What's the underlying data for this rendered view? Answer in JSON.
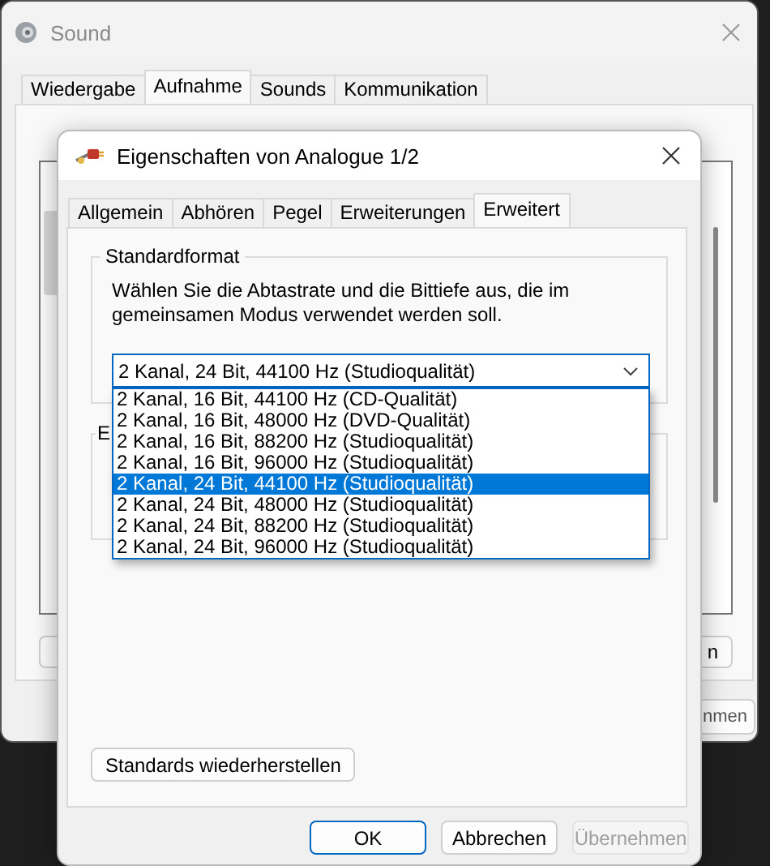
{
  "back_window": {
    "title": "Sound",
    "tabs": [
      {
        "label": "Wiedergabe",
        "selected": false
      },
      {
        "label": "Aufnahme",
        "selected": true
      },
      {
        "label": "Sounds",
        "selected": false
      },
      {
        "label": "Kommunikation",
        "selected": false
      }
    ],
    "buttons": [
      "n"
    ],
    "footer_buttons": [
      "nmen"
    ]
  },
  "dialog": {
    "title": "Eigenschaften von Analogue 1/2",
    "tabs": [
      {
        "label": "Allgemein",
        "selected": false
      },
      {
        "label": "Abhören",
        "selected": false
      },
      {
        "label": "Pegel",
        "selected": false
      },
      {
        "label": "Erweiterungen",
        "selected": false
      },
      {
        "label": "Erweitert",
        "selected": true
      }
    ],
    "format_group": {
      "title": "Standardformat",
      "description": "Wählen Sie die Abtastrate und die Bittiefe aus, die im gemeinsamen Modus verwendet werden soll.",
      "format": {
        "value": "2 Kanal, 24 Bit, 44100 Hz (Studioqualität)",
        "expanded": true,
        "options": [
          {
            "label": "2 Kanal, 16 Bit, 44100 Hz (CD-Qualität)",
            "selected": false
          },
          {
            "label": "2 Kanal, 16 Bit, 48000 Hz (DVD-Qualität)",
            "selected": false
          },
          {
            "label": "2 Kanal, 16 Bit, 88200 Hz (Studioqualität)",
            "selected": false
          },
          {
            "label": "2 Kanal, 16 Bit, 96000 Hz (Studioqualität)",
            "selected": false
          },
          {
            "label": "2 Kanal, 24 Bit, 44100 Hz (Studioqualität)",
            "selected": true
          },
          {
            "label": "2 Kanal, 24 Bit, 48000 Hz (Studioqualität)",
            "selected": false
          },
          {
            "label": "2 Kanal, 24 Bit, 88200 Hz (Studioqualität)",
            "selected": false
          },
          {
            "label": "2 Kanal, 24 Bit, 96000 Hz (Studioqualität)",
            "selected": false
          }
        ]
      }
    },
    "second_group": {
      "title": "E"
    },
    "restore_button": "Standards wiederherstellen",
    "buttons": [
      {
        "label": "OK",
        "kind": "default",
        "disabled": false
      },
      {
        "label": "Abbrechen",
        "kind": "normal",
        "disabled": false
      },
      {
        "label": "Übernehmen",
        "kind": "normal",
        "disabled": true
      }
    ]
  }
}
